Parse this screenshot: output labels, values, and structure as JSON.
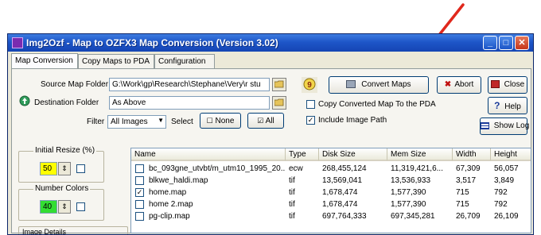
{
  "window": {
    "title": "Img2Ozf - Map to OZFX3 Map Conversion (Version 3.02)",
    "controls": [
      "_",
      "□",
      "✕"
    ]
  },
  "tabs": [
    {
      "label": "Map Conversion",
      "active": true
    },
    {
      "label": "Copy Maps to PDA",
      "active": false
    },
    {
      "label": "Configuration",
      "active": false
    }
  ],
  "source": {
    "label": "Source Map Folder",
    "value": "G:\\Work\\gp\\Research\\Stephane\\Very\\r stu"
  },
  "destination": {
    "label": "Destination Folder",
    "value": "As Above"
  },
  "filter": {
    "label": "Filter",
    "value": "All Images",
    "select_label": "Select",
    "none_label": "None",
    "all_label": "All"
  },
  "buttons": {
    "convert": "Convert Maps",
    "abort": "Abort",
    "close": "Close",
    "help": "Help",
    "show_log": "Show Log"
  },
  "options": {
    "copy_to_pda": {
      "label": "Copy Converted Map To the PDA",
      "checked": false
    },
    "include_path": {
      "label": "Include Image Path",
      "checked": true
    }
  },
  "initial_resize": {
    "label": "Initial Resize (%)",
    "value": "50"
  },
  "number_colors": {
    "label": "Number Colors",
    "value": "40"
  },
  "image_details": {
    "label": "Image Details"
  },
  "table": {
    "columns": [
      "Name",
      "Type",
      "Disk Size",
      "Mem Size",
      "Width",
      "Height"
    ],
    "rows": [
      {
        "checked": false,
        "name": "bc_093gne_utvbt/m_utm10_1995_20...",
        "type": "ecw",
        "disk": "268,455,124",
        "mem": "11,319,421,6...",
        "width": "67,309",
        "height": "56,057"
      },
      {
        "checked": false,
        "name": "blkwe_haldi.map",
        "type": "tif",
        "disk": "13,569,041",
        "mem": "13,536,933",
        "width": "3,517",
        "height": "3,849"
      },
      {
        "checked": true,
        "name": "home.map",
        "type": "tif",
        "disk": "1,678,474",
        "mem": "1,577,390",
        "width": "715",
        "height": "792"
      },
      {
        "checked": false,
        "name": "home 2.map",
        "type": "tif",
        "disk": "1,678,474",
        "mem": "1,577,390",
        "width": "715",
        "height": "792"
      },
      {
        "checked": false,
        "name": "pg-clip.map",
        "type": "tif",
        "disk": "697,764,333",
        "mem": "697,345,281",
        "width": "26,709",
        "height": "26,109"
      }
    ]
  },
  "colors": {
    "annotation_arrow": "#e0281c",
    "title_bar": "#1e56c8",
    "resize_field": "#ffff00",
    "colors_field": "#33dd33"
  }
}
